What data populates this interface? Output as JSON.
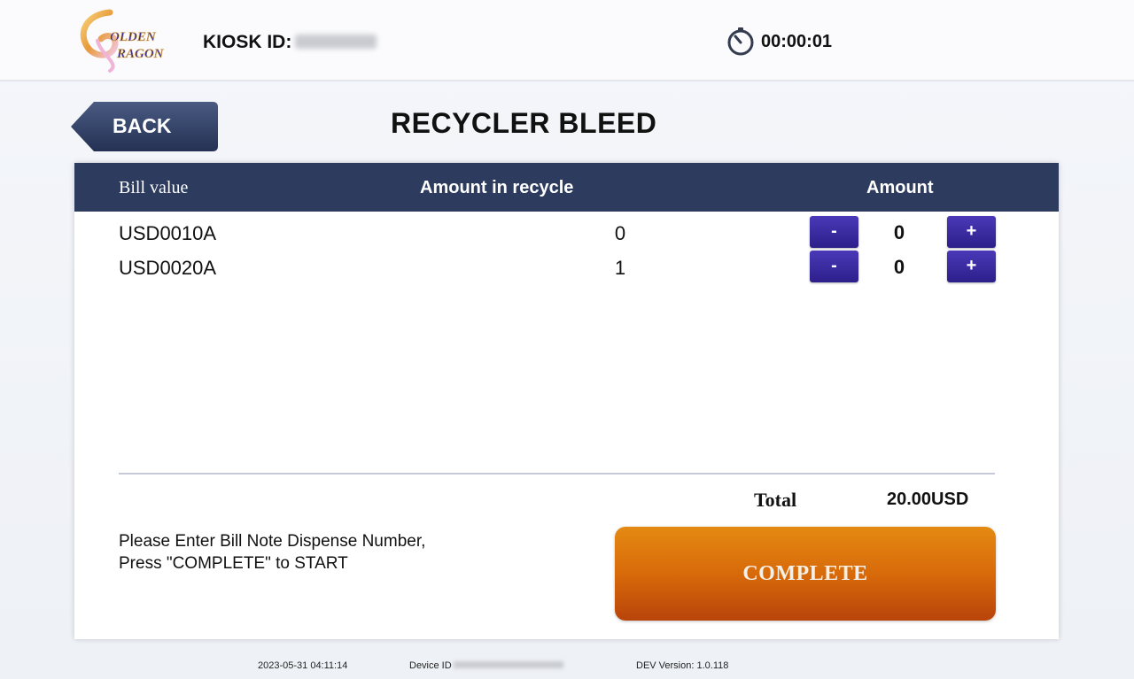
{
  "header": {
    "logo_text": "GOLDEN DRAGON",
    "kiosk_label": "KIOSK ID:",
    "timer": "00:00:01"
  },
  "nav": {
    "back_label": "BACK",
    "title": "RECYCLER BLEED"
  },
  "table": {
    "columns": [
      "Bill value",
      "Amount in recycle",
      "Amount"
    ],
    "rows": [
      {
        "bill": "USD0010A",
        "in_recycle": "0",
        "amount": "0",
        "minus": "-",
        "plus": "+"
      },
      {
        "bill": "USD0020A",
        "in_recycle": "1",
        "amount": "0",
        "minus": "-",
        "plus": "+"
      }
    ]
  },
  "summary": {
    "total_label": "Total",
    "total_value": "20.00USD"
  },
  "instructions": [
    "Please Enter Bill Note Dispense Number,",
    "Press \"COMPLETE\" to START"
  ],
  "actions": {
    "complete_label": "COMPLETE"
  },
  "footer": {
    "timestamp": "2023-05-31 04:11:14",
    "device_label": "Device ID",
    "version": "DEV Version: 1.0.118"
  },
  "colors": {
    "header_bar": "#2c3b5e",
    "stepper": "#3a2ca0",
    "complete": "#d86a0a",
    "back": "#2f3c60"
  }
}
